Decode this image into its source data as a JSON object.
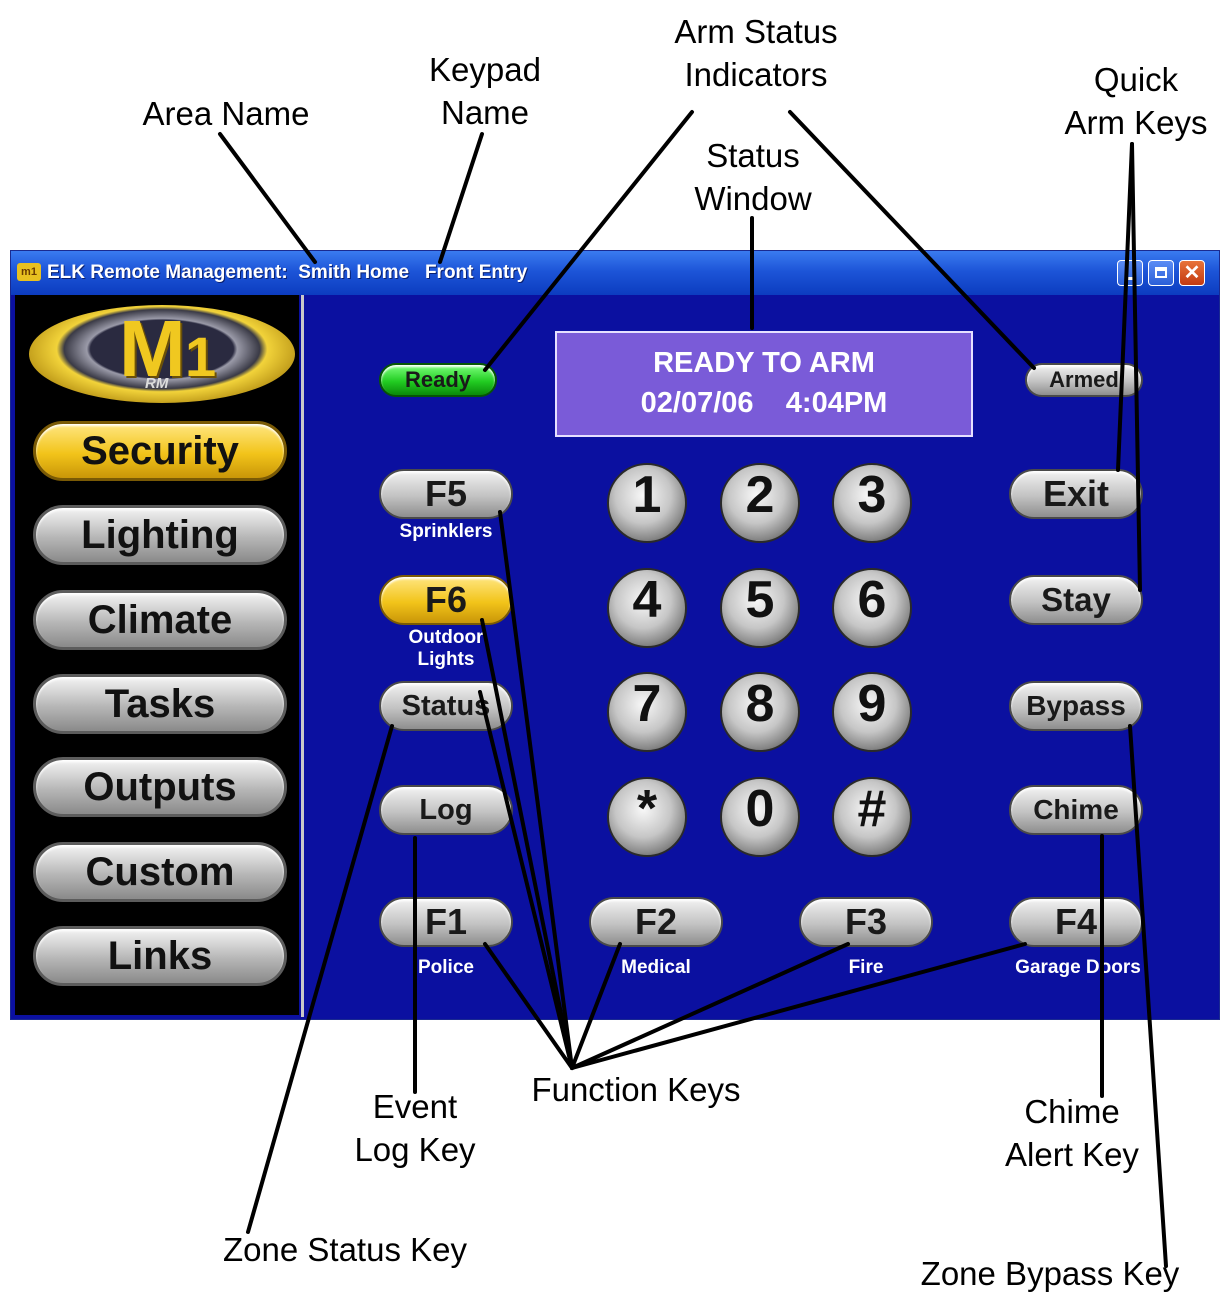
{
  "callouts": {
    "area_name": "Area Name",
    "keypad_name": "Keypad\nName",
    "arm_status_indicators": "Arm Status\nIndicators",
    "status_window": "Status\nWindow",
    "quick_arm_keys": "Quick\nArm Keys",
    "event_log_key": "Event\nLog Key",
    "function_keys": "Function Keys",
    "chime_alert_key": "Chime\nAlert Key",
    "zone_status_key": "Zone Status Key",
    "zone_bypass_key": "Zone Bypass Key"
  },
  "window": {
    "title": "ELK Remote Management:  Smith Home   Front Entry",
    "icon_text": "m1",
    "close_glyph": "✕"
  },
  "logo": {
    "main": "M",
    "sub": "1",
    "rm": "RM"
  },
  "sidebar": {
    "items": [
      {
        "label": "Security",
        "active": true
      },
      {
        "label": "Lighting"
      },
      {
        "label": "Climate"
      },
      {
        "label": "Tasks"
      },
      {
        "label": "Outputs"
      },
      {
        "label": "Custom"
      },
      {
        "label": "Links"
      }
    ]
  },
  "indicators": {
    "ready": "Ready",
    "armed": "Armed"
  },
  "status_window": {
    "line1": "READY TO ARM",
    "line2": "02/07/06    4:04PM"
  },
  "function_keys": {
    "f5": {
      "key": "F5",
      "label": "Sprinklers"
    },
    "f6": {
      "key": "F6",
      "label": "Outdoor\nLights"
    },
    "status": "Status",
    "log": "Log",
    "f1": {
      "key": "F1",
      "label": "Police"
    },
    "f2": {
      "key": "F2",
      "label": "Medical"
    },
    "f3": {
      "key": "F3",
      "label": "Fire"
    },
    "f4": {
      "key": "F4",
      "label": "Garage Doors"
    }
  },
  "keypad": [
    "1",
    "2",
    "3",
    "4",
    "5",
    "6",
    "7",
    "8",
    "9",
    "*",
    "0",
    "#"
  ],
  "quick_arm": {
    "exit": "Exit",
    "stay": "Stay",
    "bypass": "Bypass",
    "chime": "Chime"
  },
  "colors": {
    "window_bg": "#0b10a0",
    "accent_yellow": "#f2c41a",
    "ready_green": "#22cc22",
    "status_purple": "#7a5bd8"
  }
}
